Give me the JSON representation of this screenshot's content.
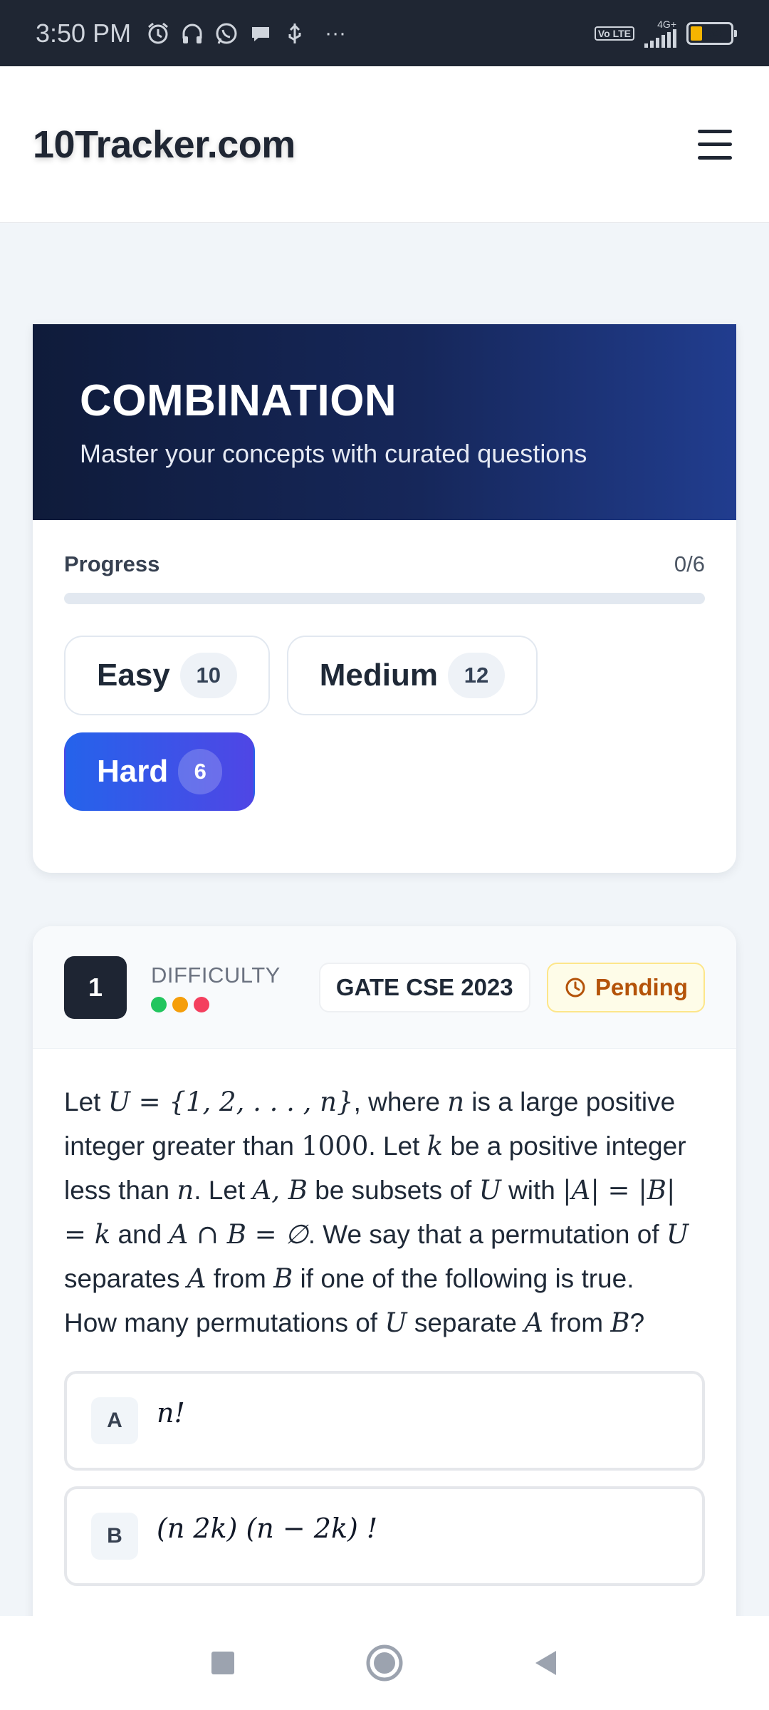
{
  "status_bar": {
    "time": "3:50 PM",
    "icons": [
      "alarm-icon",
      "headphones-icon",
      "whatsapp-icon",
      "chat-icon",
      "usb-icon",
      "more-icon"
    ],
    "more": "···",
    "network": "4G+",
    "volte": "Vo LTE",
    "battery": "34"
  },
  "header": {
    "logo": "10Tracker.com"
  },
  "topic": {
    "title": "COMBINATION",
    "subtitle": "Master your concepts with curated questions",
    "progress_label": "Progress",
    "progress_count": "0/6",
    "progress_value": 0,
    "filters": [
      {
        "label": "Easy",
        "count": "10",
        "active": false
      },
      {
        "label": "Medium",
        "count": "12",
        "active": false
      },
      {
        "label": "Hard",
        "count": "6",
        "active": true
      }
    ]
  },
  "question": {
    "number": "1",
    "difficulty_label": "DIFFICULTY",
    "difficulty_colors": [
      "#22c55e",
      "#f59e0b",
      "#f43f5e"
    ],
    "exam": "GATE CSE 2023",
    "status": "Pending",
    "text": {
      "t1": "Let ",
      "m1": "U = {1, 2, . . . , n}",
      "t2": ", where ",
      "m2": "n",
      "t3": " is a large positive integer greater than ",
      "m3": "1000",
      "t4": ". Let ",
      "m4": "k",
      "t5": " be a positive integer less than ",
      "m5": "n",
      "t6": ". Let ",
      "m6": "A, B",
      "t7": " be subsets of ",
      "m7": "U",
      "t8": " with ",
      "m8": "|A| = |B| = k",
      "t9": " and ",
      "m9": "A ∩ B = ∅",
      "t10": ". We say that a permutation of ",
      "m10": "U",
      "t11": " separates ",
      "m11": "A",
      "t12": " from ",
      "m12": "B",
      "t13": " if one of the following is true.",
      "t14": "How many permutations of ",
      "m14": "U",
      "t15": " separate ",
      "m15": "A",
      "t16": " from ",
      "m16": "B",
      "t17": "?"
    },
    "options": [
      {
        "letter": "A",
        "text": "n!"
      },
      {
        "letter": "B",
        "text": "(n 2k) (n − 2k) !"
      }
    ]
  },
  "colors": {
    "hero_start": "#0f1b3a",
    "hero_end": "#213d8f",
    "accent": "#2563eb",
    "pending": "#b45309"
  }
}
